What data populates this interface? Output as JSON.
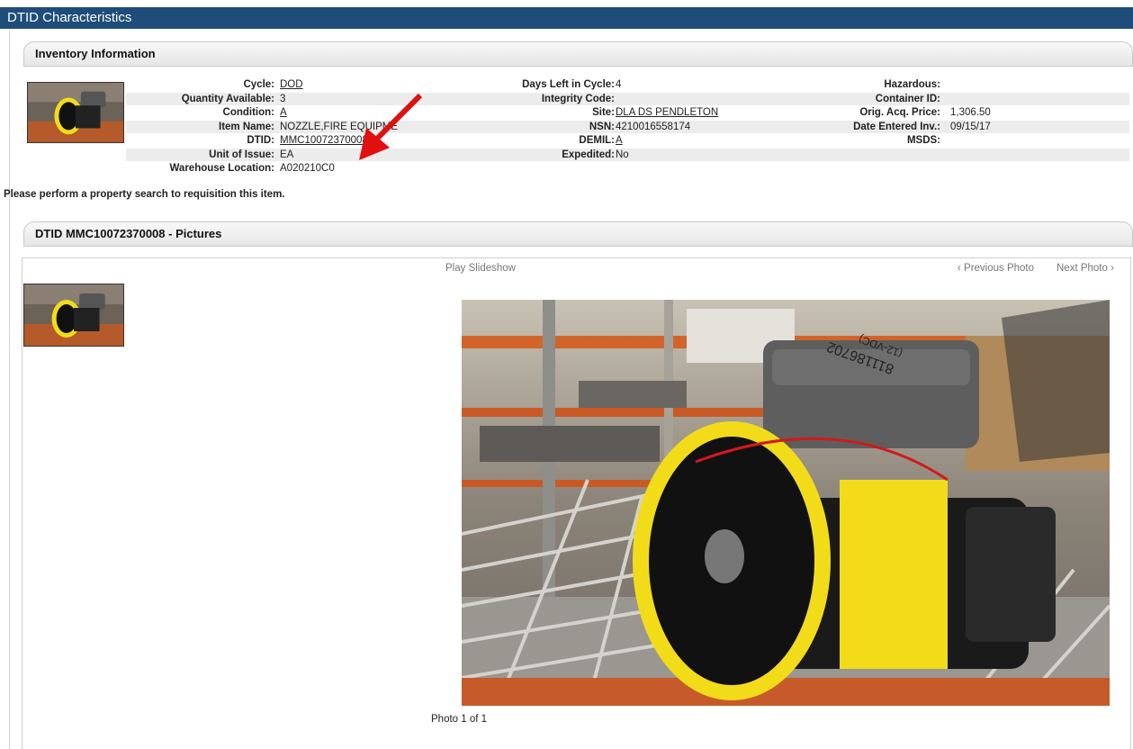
{
  "window": {
    "title": "DTID Characteristics"
  },
  "inventory": {
    "header": "Inventory Information",
    "col1": [
      {
        "label": "Cycle:",
        "value": "DOD",
        "link": true
      },
      {
        "label": "Quantity Available:",
        "value": "3",
        "link": false
      },
      {
        "label": "Condition:",
        "value": "A",
        "link": true
      },
      {
        "label": "Item Name:",
        "value": "NOZZLE,FIRE EQUIPME",
        "link": false
      },
      {
        "label": "DTID:",
        "value": "MMC10072370008",
        "link": true
      },
      {
        "label": "Unit of Issue:",
        "value": "EA",
        "link": false
      },
      {
        "label": "Warehouse Location:",
        "value": "A020210C0",
        "link": false
      }
    ],
    "col2": [
      {
        "label": "Days Left in Cycle:",
        "value": "4",
        "link": false
      },
      {
        "label": "Integrity Code:",
        "value": "",
        "link": false
      },
      {
        "label": "Site:",
        "value": "DLA DS PENDLETON",
        "link": true
      },
      {
        "label": "NSN:",
        "value": "4210016558174",
        "link": false
      },
      {
        "label": "DEMIL:",
        "value": "A",
        "link": true
      },
      {
        "label": "Expedited:",
        "value": "No",
        "link": false
      }
    ],
    "col3": [
      {
        "label": "Hazardous:",
        "value": ""
      },
      {
        "label": "Container ID:",
        "value": ""
      },
      {
        "label": "Orig. Acq. Price:",
        "value": "1,306.50"
      },
      {
        "label": "Date Entered Inv.:",
        "value": "09/15/17"
      },
      {
        "label": "MSDS:",
        "value": ""
      }
    ],
    "note": "Please perform a property search to requisition this item."
  },
  "pictures": {
    "header": "DTID MMC10072370008 - Pictures",
    "play_slideshow": "Play Slideshow",
    "previous_photo": "‹ Previous Photo",
    "next_photo": "Next Photo ›",
    "caption": "Photo 1 of 1",
    "photo_label_1": "811186702",
    "photo_label_2": "(12-VDC)"
  },
  "colors": {
    "titlebar": "#1f4d7a",
    "annotation_arrow": "#e01010",
    "nozzle_yellow": "#f2dc1a"
  }
}
